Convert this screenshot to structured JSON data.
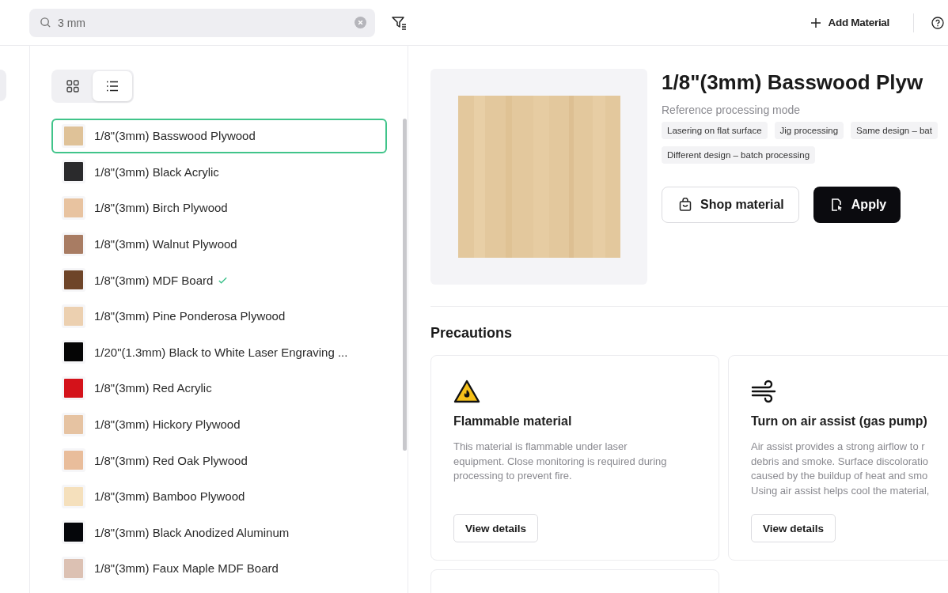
{
  "search": {
    "value": "3 mm"
  },
  "toolbar": {
    "add_button": "Add Material"
  },
  "view_toggle": [
    {
      "kind": "grid",
      "selected": false
    },
    {
      "kind": "list",
      "selected": true
    }
  ],
  "materials": [
    {
      "name": "1/8\"(3mm) Basswood Plywood",
      "color": "#dfc298",
      "selected": true,
      "applied": false
    },
    {
      "name": "1/8\"(3mm) Black Acrylic",
      "color": "#2a2a2c",
      "selected": false,
      "applied": false
    },
    {
      "name": "1/8\"(3mm) Birch Plywood",
      "color": "#e8c3a0",
      "selected": false,
      "applied": false
    },
    {
      "name": "1/8\"(3mm) Walnut Plywood",
      "color": "#a87c63",
      "selected": false,
      "applied": false
    },
    {
      "name": "1/8\"(3mm) MDF Board",
      "color": "#6e4529",
      "selected": false,
      "applied": true
    },
    {
      "name": "1/8\"(3mm) Pine Ponderosa Plywood",
      "color": "#ecd0b0",
      "selected": false,
      "applied": false
    },
    {
      "name": "1/20\"(1.3mm) Black to White Laser Engraving ...",
      "color": "#050505",
      "selected": false,
      "applied": false
    },
    {
      "name": "1/8\"(3mm) Red Acrylic",
      "color": "#d4121a",
      "selected": false,
      "applied": false
    },
    {
      "name": "1/8\"(3mm) Hickory Plywood",
      "color": "#e6c3a2",
      "selected": false,
      "applied": false
    },
    {
      "name": "1/8\"(3mm) Red Oak Plywood",
      "color": "#e9bd9b",
      "selected": false,
      "applied": false
    },
    {
      "name": "1/8\"(3mm) Bamboo Plywood",
      "color": "#f5e0bc",
      "selected": false,
      "applied": false
    },
    {
      "name": "1/8\"(3mm) Black Anodized Aluminum",
      "color": "#05060a",
      "selected": false,
      "applied": false
    },
    {
      "name": "1/8\"(3mm) Faux Maple MDF Board",
      "color": "#dcc1b3",
      "selected": false,
      "applied": false
    }
  ],
  "detail": {
    "title": "1/8\"(3mm) Basswood Plyw",
    "mode_label": "Reference processing mode",
    "tags": [
      "Lasering on flat surface",
      "Jig processing",
      "Same design – bat",
      "Different design – batch processing"
    ],
    "shop_button": "Shop material",
    "apply_button": "Apply"
  },
  "precautions": {
    "heading": "Precautions",
    "cards": [
      {
        "kind": "fire",
        "title": "Flammable material",
        "lines": [
          "This material is flammable under laser",
          "equipment. Close monitoring is required during",
          "processing to prevent fire."
        ],
        "button": "View details"
      },
      {
        "kind": "air",
        "title": "Turn on air assist (gas pump)",
        "lines": [
          "Air assist provides a strong airflow to r",
          "debris and smoke. Surface discoloratio",
          "caused by the buildup of heat and smo",
          "Using air assist helps cool the material,"
        ],
        "button": "View details"
      }
    ]
  }
}
